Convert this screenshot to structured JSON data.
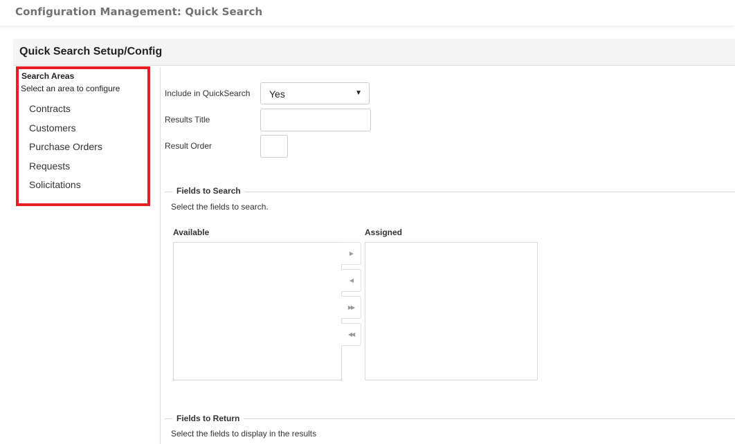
{
  "page": {
    "title": "Configuration Management: Quick Search"
  },
  "panel": {
    "title": "Quick Search Setup/Config"
  },
  "search_areas": {
    "heading": "Search Areas",
    "subheading": "Select an area to configure",
    "items": [
      {
        "label": "Contracts"
      },
      {
        "label": "Customers"
      },
      {
        "label": "Purchase Orders"
      },
      {
        "label": "Requests"
      },
      {
        "label": "Solicitations"
      }
    ],
    "highlight_color": "#e81c24"
  },
  "form": {
    "include_label": "Include in QuickSearch",
    "include_value": "Yes",
    "results_title_label": "Results Title",
    "results_title_value": "",
    "result_order_label": "Result Order",
    "result_order_value": ""
  },
  "fields_to_search": {
    "legend": "Fields to Search",
    "help": "Select the fields to search.",
    "available_label": "Available",
    "assigned_label": "Assigned",
    "available_items": [],
    "assigned_items": [],
    "buttons": {
      "move_right": "▶",
      "move_left": "◀",
      "move_all_right": "▶▶",
      "move_all_left": "◀◀"
    }
  },
  "fields_to_return": {
    "legend": "Fields to Return",
    "help": "Select the fields to display in the results"
  }
}
